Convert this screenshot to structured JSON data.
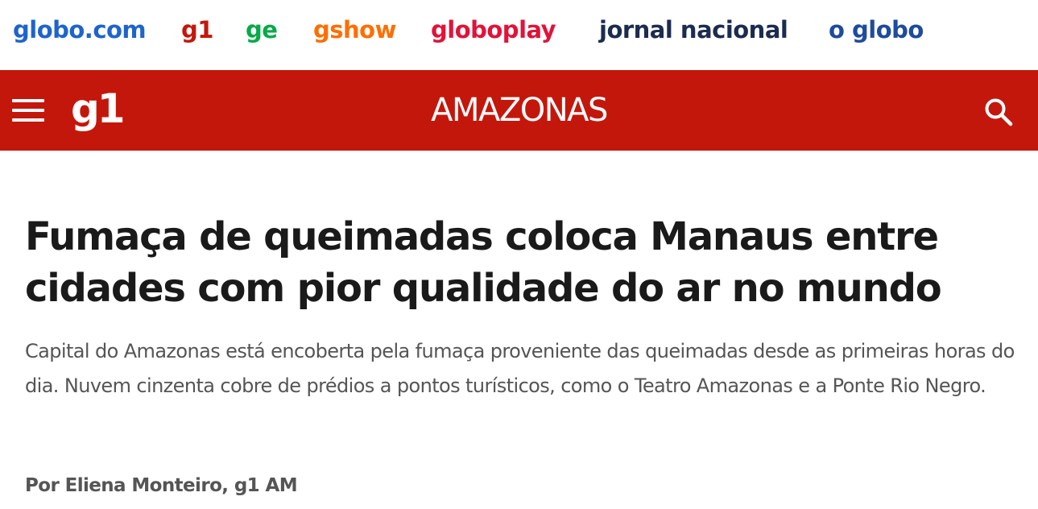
{
  "network_bar": {
    "links": [
      {
        "label": "globo.com",
        "color": "#1E64CC"
      },
      {
        "label": "g1",
        "color": "#C4170C"
      },
      {
        "label": "ge",
        "color": "#06AA48"
      },
      {
        "label": "gshow",
        "color": "#FF6E00"
      },
      {
        "label": "globoplay",
        "color": "#E0133A"
      },
      {
        "label": "jornal nacional",
        "color": "#1B2C4E"
      },
      {
        "label": "o globo",
        "color": "#1E4B9C"
      }
    ]
  },
  "header": {
    "background_color": "#C4170C",
    "logo": "g1",
    "section_title": "AMAZONAS",
    "menu_icon": "hamburger-menu-icon",
    "search_icon": "search-icon"
  },
  "article": {
    "headline": "Fumaça de queimadas coloca Manaus entre cidades com pior qualidade do ar no mundo",
    "subtitle": "Capital do Amazonas está encoberta pela fumaça proveniente das queimadas desde as primeiras horas do dia. Nuvem cinzenta cobre de prédios a pontos turísticos, como o Teatro Amazonas e a Ponte Rio Negro.",
    "byline": "Por Eliena Monteiro, g1 AM"
  }
}
